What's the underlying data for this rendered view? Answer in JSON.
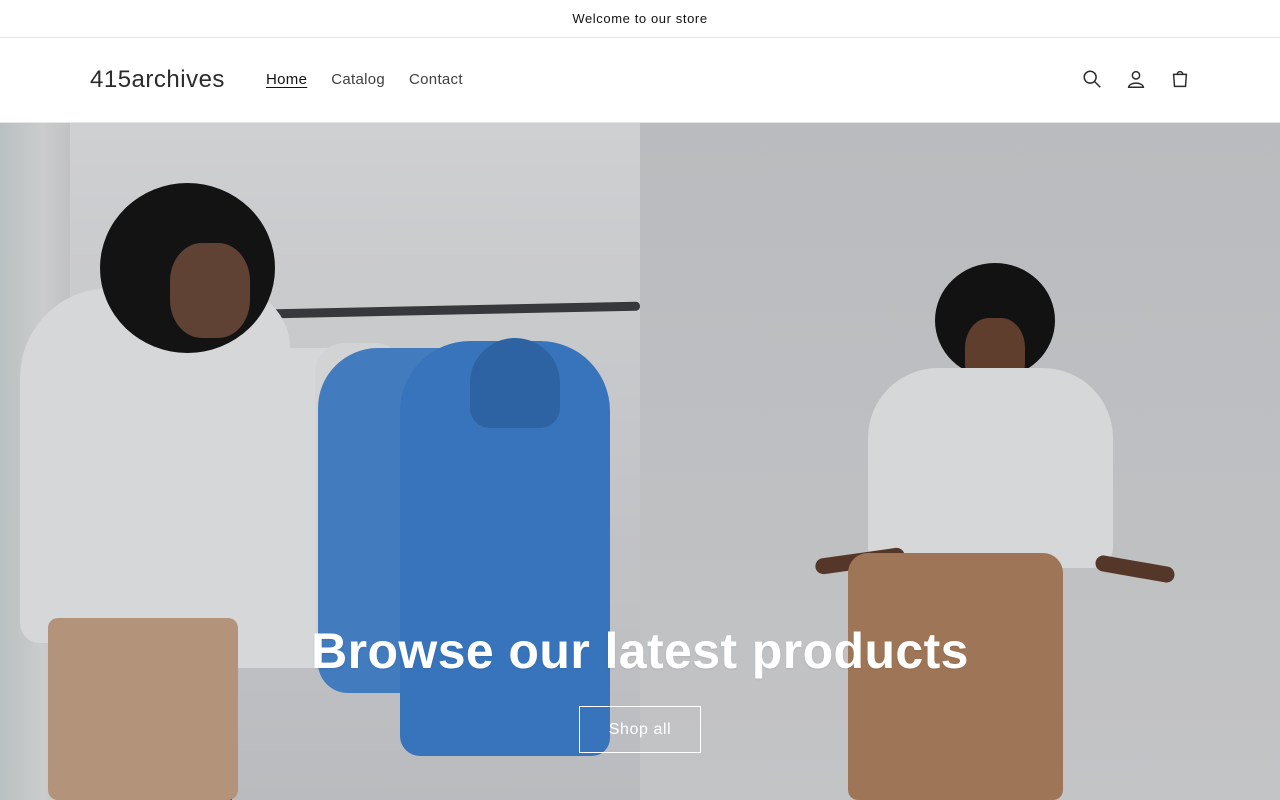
{
  "announcement": {
    "text": "Welcome to our store"
  },
  "header": {
    "logo": "415archives",
    "nav": [
      {
        "label": "Home",
        "active": true
      },
      {
        "label": "Catalog",
        "active": false
      },
      {
        "label": "Contact",
        "active": false
      }
    ],
    "icons": [
      "search-icon",
      "account-icon",
      "cart-icon"
    ]
  },
  "hero": {
    "title": "Browse our latest products",
    "button_label": "Shop all"
  }
}
